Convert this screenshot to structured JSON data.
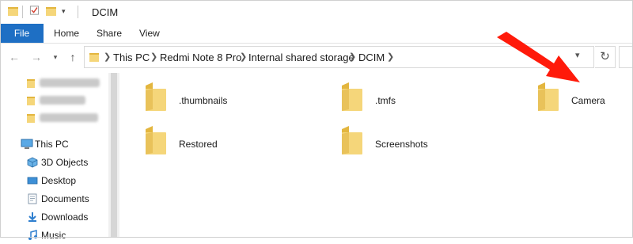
{
  "window": {
    "title": "DCIM"
  },
  "ribbon": {
    "file_label": "File",
    "tabs": [
      "Home",
      "Share",
      "View"
    ]
  },
  "address": {
    "crumbs": [
      "This PC",
      "Redmi Note 8 Pro",
      "Internal shared storage",
      "DCIM"
    ]
  },
  "sidebar": {
    "quick_access": [
      {
        "label": "how to transfer p",
        "blurred": true
      },
      {
        "label": "JBL Extreme 2",
        "blurred": true
      },
      {
        "label": "Razer Yoga Trini",
        "blurred": true
      }
    ],
    "this_pc_label": "This PC",
    "items": [
      {
        "label": "3D Objects",
        "icon": "3d-objects-icon"
      },
      {
        "label": "Desktop",
        "icon": "desktop-icon"
      },
      {
        "label": "Documents",
        "icon": "documents-icon"
      },
      {
        "label": "Downloads",
        "icon": "downloads-icon"
      },
      {
        "label": "Music",
        "icon": "music-icon"
      }
    ]
  },
  "folders": [
    {
      "name": ".thumbnails"
    },
    {
      "name": ".tmfs"
    },
    {
      "name": "Camera"
    },
    {
      "name": "Restored"
    },
    {
      "name": "Screenshots"
    }
  ],
  "colors": {
    "accent": "#1e6fc4",
    "folder": "#f5d67a",
    "folder_dark": "#e3b63f",
    "annotation_arrow": "#ff1a0a"
  }
}
